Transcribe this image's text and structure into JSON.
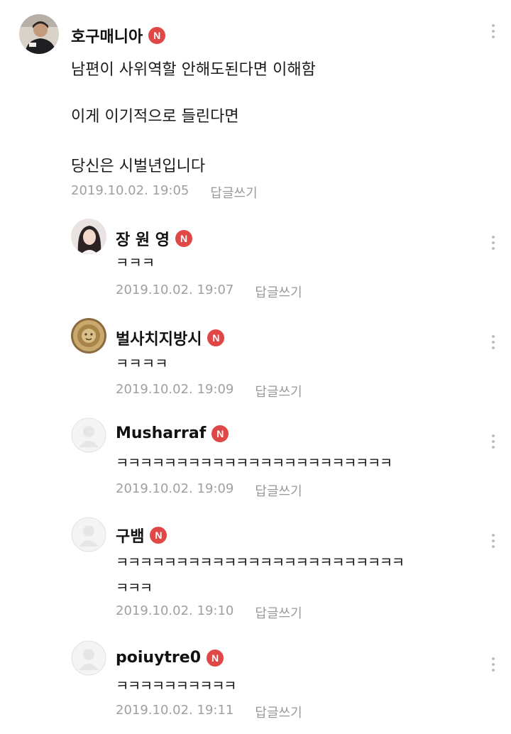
{
  "comments": [
    {
      "author": "호구매니아",
      "badge": "N",
      "lines": [
        "남편이 사위역할 안해도된다면 이해함",
        "이게 이기적으로 들린다면",
        "당신은 시벌년입니다"
      ],
      "date": "2019.10.02. 19:05",
      "reply_label": "답글쓰기",
      "avatar": "man-photo-avatar"
    },
    {
      "author": "장 원 영",
      "badge": "N",
      "lines": [
        "ㅋㅋㅋ"
      ],
      "date": "2019.10.02. 19:07",
      "reply_label": "답글쓰기",
      "avatar": "woman-photo-avatar"
    },
    {
      "author": "벌사치지방시",
      "badge": "N",
      "lines": [
        "ㅋㅋㅋㅋ"
      ],
      "date": "2019.10.02. 19:09",
      "reply_label": "답글쓰기",
      "avatar": "medusa-logo-avatar"
    },
    {
      "author": "Musharraf",
      "badge": "N",
      "lines": [
        "ㅋㅋㅋㅋㅋㅋㅋㅋㅋㅋㅋㅋㅋㅋㅋㅋㅋㅋㅋㅋㅋㅋㅋ"
      ],
      "date": "2019.10.02. 19:09",
      "reply_label": "답글쓰기",
      "avatar": "default-avatar"
    },
    {
      "author": "구뱀",
      "badge": "N",
      "lines": [
        "ㅋㅋㅋㅋㅋㅋㅋㅋㅋㅋㅋㅋㅋㅋㅋㅋㅋㅋㅋㅋㅋㅋㅋㅋ",
        "ㅋㅋㅋ"
      ],
      "date": "2019.10.02. 19:10",
      "reply_label": "답글쓰기",
      "avatar": "default-avatar"
    },
    {
      "author": "poiuytre0",
      "badge": "N",
      "lines": [
        "ㅋㅋㅋㅋㅋㅋㅋㅋㅋㅋ"
      ],
      "date": "2019.10.02. 19:11",
      "reply_label": "답글쓰기",
      "avatar": "default-avatar"
    }
  ],
  "colors": {
    "badge": "#e04848",
    "meta": "#a0a0a0",
    "more_dots": "#bdbdbd"
  }
}
